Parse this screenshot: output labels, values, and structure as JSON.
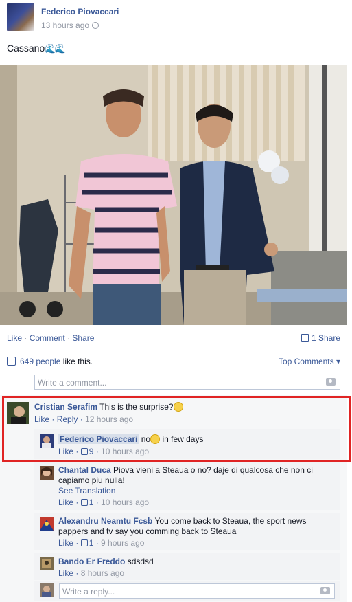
{
  "post": {
    "author": "Federico Piovaccari",
    "time": "13 hours ago",
    "text": "Cassano",
    "text_emoji": "🌊🌊"
  },
  "actions": {
    "like": "Like",
    "comment": "Comment",
    "share": "Share",
    "sep": "·",
    "share_count": "1 Share"
  },
  "likes": {
    "count": "649 people",
    "suffix": "like this.",
    "sort": "Top Comments ▾"
  },
  "write_comment_placeholder": "Write a comment...",
  "comments": [
    {
      "name": "Cristian Serafim",
      "text": "This is the surprise?",
      "like": "Like",
      "reply": "Reply",
      "time": "12 hours ago"
    }
  ],
  "replies": [
    {
      "name": "Federico Piovaccari",
      "text_a": "no",
      "text_b": "in few days",
      "like": "Like",
      "likes": "9",
      "time": "10 hours ago"
    },
    {
      "name": "Chantal Duca",
      "text": "Piova vieni a Steaua o no? daje di qualcosa che non ci capiamo piu nulla!",
      "see_translation": "See Translation",
      "like": "Like",
      "likes": "1",
      "time": "10 hours ago"
    },
    {
      "name": "Alexandru Neamtu Fcsb",
      "text": "You come back to Steaua, the sport news pappers and tv say you comming back to Steaua",
      "like": "Like",
      "likes": "1",
      "time": "9 hours ago"
    },
    {
      "name": "Bando Er Freddo",
      "text": "sdsdsd",
      "like": "Like",
      "time": "8 hours ago"
    }
  ],
  "write_reply_placeholder": "Write a reply...",
  "colors": {
    "link": "#3b5998",
    "muted": "#9197a3",
    "highlight": "#e02424"
  },
  "icons": [
    "globe-icon",
    "like-thumb-icon",
    "share-icon",
    "camera-icon",
    "emoji-icon"
  ]
}
